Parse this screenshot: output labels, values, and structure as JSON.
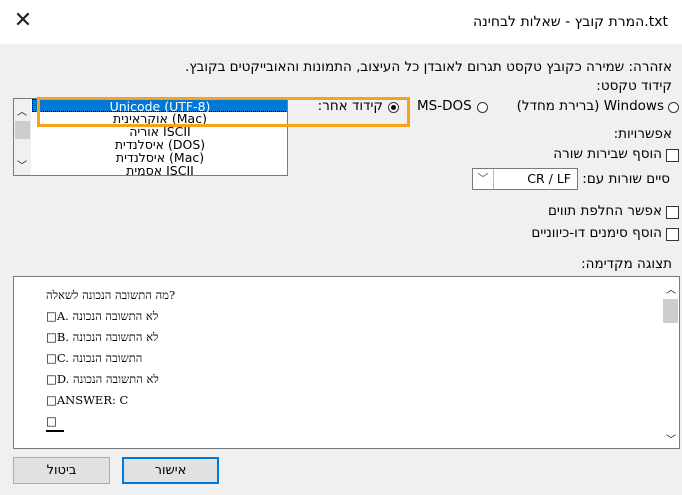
{
  "window": {
    "title": "המרת קובץ - שאלות לבחינה.txt",
    "close_glyph": "✕"
  },
  "warning": "אזהרה: שמירה כקובץ טקסט תגרום לאובדן כל העיצוב, התמונות והאובייקטים בקובץ.",
  "encoding": {
    "label": "קידוד טקסט:",
    "options": [
      {
        "label": "Windows (ברירת מחדל)",
        "selected": false
      },
      {
        "label": "MS-DOS",
        "selected": false
      },
      {
        "label": "קידוד אחר:",
        "selected": true
      }
    ],
    "list_items": [
      "Unicode (UTF-8)",
      "אוקראינית (Mac)",
      "אוריה ISCII",
      "איסלנדית (DOS)",
      "איסלנדית (Mac)",
      "אסמית ISCII"
    ],
    "selected_item": "Unicode (UTF-8)"
  },
  "options": {
    "label": "אפשרויות:",
    "insert_line_breaks": {
      "label": "הוסף שבירות שורה",
      "checked": false
    },
    "end_lines_with": {
      "label": "סיים שורות עם:",
      "value": "CR / LF"
    },
    "allow_substitution": {
      "label": "אפשר החלפת תווים",
      "checked": false
    },
    "bidi_marks": {
      "label": "הוסף סימנים דו-כיווניים",
      "checked": false
    }
  },
  "preview": {
    "label": "תצוגה מקדימה:",
    "lines": [
      "?מה התשובה הנכונה לשאלה",
      "□A. לא התשובה הנכונה",
      "□B. לא התשובה הנכונה",
      "□C. התשובה הנכונה",
      "□D. לא התשובה הנכונה",
      "□ANSWER: C",
      "□"
    ]
  },
  "buttons": {
    "ok": "אישור",
    "cancel": "ביטול"
  },
  "colors": {
    "accent": "#0078d7",
    "highlight": "#f7a21b"
  }
}
